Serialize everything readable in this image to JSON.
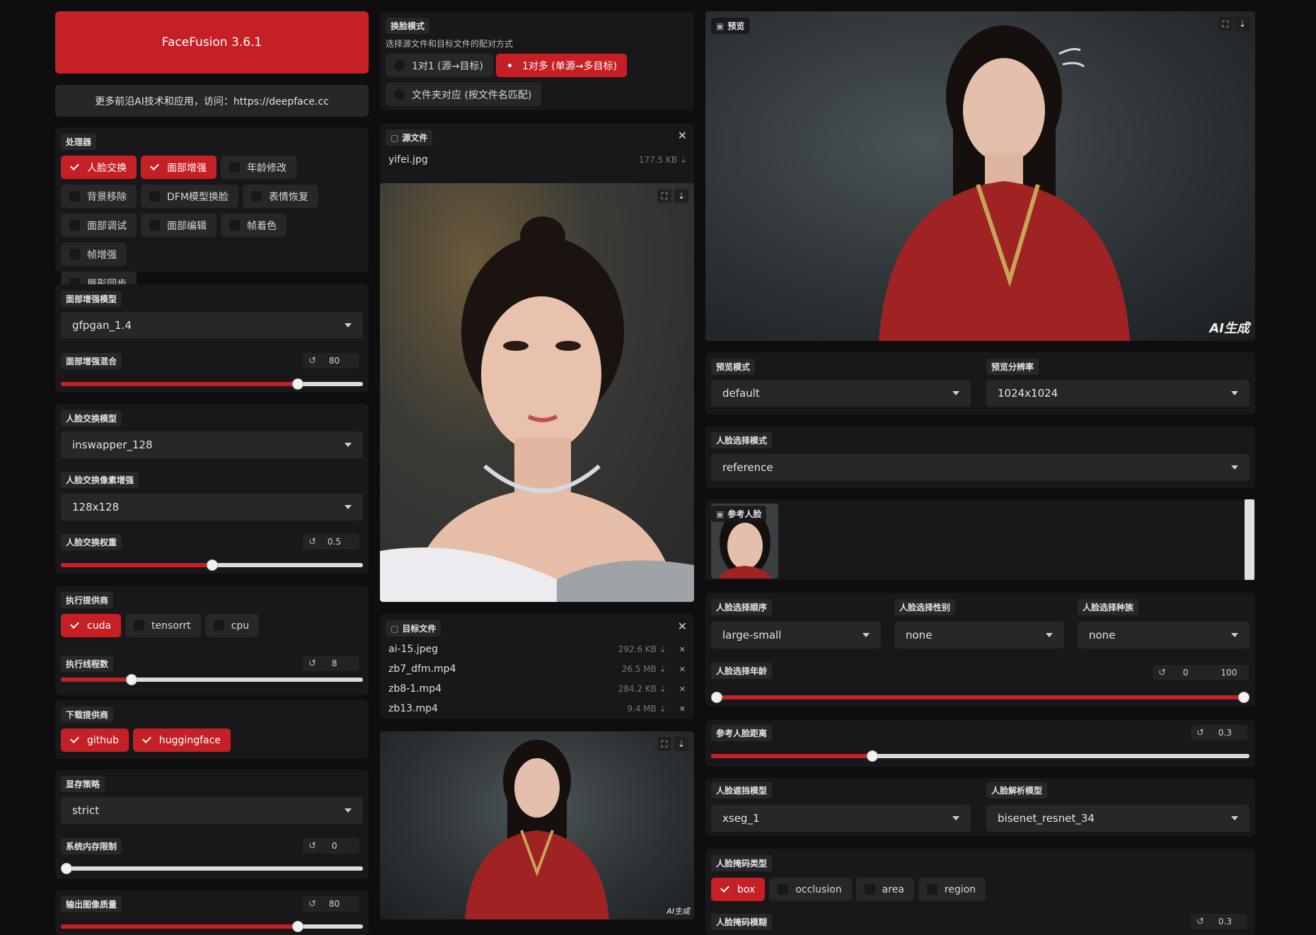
{
  "app": {
    "title": "FaceFusion 3.6.1",
    "banner": "更多前沿AI技术和应用，访问：https://deepface.cc"
  },
  "processors": {
    "label": "处理器",
    "items": [
      {
        "label": "人脸交换",
        "checked": true
      },
      {
        "label": "面部增强",
        "checked": true
      },
      {
        "label": "年龄修改",
        "checked": false
      },
      {
        "label": "背景移除",
        "checked": false
      },
      {
        "label": "DFM模型换脸",
        "checked": false
      },
      {
        "label": "表情恢复",
        "checked": false
      },
      {
        "label": "面部调试",
        "checked": false
      },
      {
        "label": "面部编辑",
        "checked": false
      },
      {
        "label": "帧着色",
        "checked": false
      },
      {
        "label": "帧增强",
        "checked": false
      },
      {
        "label": "唇形同步",
        "checked": false
      }
    ]
  },
  "face_enhancer": {
    "model_label": "面部增强模型",
    "model_value": "gfpgan_1.4",
    "blend_label": "面部增强混合",
    "blend_value": "80",
    "blend_fraction": 0.785
  },
  "face_swapper": {
    "model_label": "人脸交换模型",
    "model_value": "inswapper_128",
    "pixel_boost_label": "人脸交换像素增强",
    "pixel_boost_value": "128x128",
    "weight_label": "人脸交换权重",
    "weight_value": "0.5",
    "weight_fraction": 0.5
  },
  "execution": {
    "providers_label": "执行提供商",
    "providers": [
      {
        "label": "cuda",
        "checked": true
      },
      {
        "label": "tensorrt",
        "checked": false
      },
      {
        "label": "cpu",
        "checked": false
      }
    ],
    "threads_label": "执行线程数",
    "threads_value": "8",
    "threads_fraction": 0.235
  },
  "download": {
    "providers_label": "下载提供商",
    "providers": [
      {
        "label": "github",
        "checked": true
      },
      {
        "label": "huggingface",
        "checked": true
      }
    ]
  },
  "memory": {
    "strategy_label": "显存策略",
    "strategy_value": "strict",
    "limit_label": "系统内存限制",
    "limit_value": "0",
    "limit_fraction": 0.0
  },
  "output": {
    "image_quality_label": "输出图像质量",
    "image_quality_value": "80",
    "image_quality_fraction": 0.785
  },
  "swap_mode": {
    "label": "换脸模式",
    "description": "选择源文件和目标文件的配对方式",
    "options": [
      {
        "label": "1对1 (源→目标)",
        "selected": false
      },
      {
        "label": "1对多 (单源→多目标)",
        "selected": true
      },
      {
        "label": "文件夹对应 (按文件名匹配)",
        "selected": false
      }
    ]
  },
  "source": {
    "label": "源文件",
    "file_name": "yifei.jpg",
    "file_size": "177.5 KB"
  },
  "target": {
    "label": "目标文件",
    "files": [
      {
        "name": "ai-15.jpeg",
        "size": "292.6 KB"
      },
      {
        "name": "zb7_dfm.mp4",
        "size": "26.5 MB"
      },
      {
        "name": "zb8-1.mp4",
        "size": "284.2 KB"
      },
      {
        "name": "zb13.mp4",
        "size": "9.4 MB"
      }
    ]
  },
  "watermark": "AI生成",
  "preview": {
    "label": "预览",
    "mode_label": "预览模式",
    "mode_value": "default",
    "resolution_label": "预览分辨率",
    "resolution_value": "1024x1024"
  },
  "face_selector": {
    "mode_label": "人脸选择模式",
    "mode_value": "reference",
    "reference_label": "参考人脸",
    "order_label": "人脸选择顺序",
    "order_value": "large-small",
    "gender_label": "人脸选择性别",
    "gender_value": "none",
    "race_label": "人脸选择种族",
    "race_value": "none",
    "age_label": "人脸选择年龄",
    "age_start": "0",
    "age_end": "100",
    "age_start_fraction": 0.0,
    "age_end_fraction": 1.0,
    "ref_distance_label": "参考人脸距离",
    "ref_distance_value": "0.3",
    "ref_distance_fraction": 0.3
  },
  "face_masker": {
    "occluder_label": "人脸遮挡模型",
    "occluder_value": "xseg_1",
    "parser_label": "人脸解析模型",
    "parser_value": "bisenet_resnet_34",
    "types_label": "人脸掩码类型",
    "types": [
      {
        "label": "box",
        "checked": true
      },
      {
        "label": "occlusion",
        "checked": false
      },
      {
        "label": "area",
        "checked": false
      },
      {
        "label": "region",
        "checked": false
      }
    ],
    "blur_label": "人脸掩码模糊",
    "blur_value": "0.3"
  },
  "icons": {
    "reset": "reset-icon",
    "fullscreen": "fullscreen-icon",
    "download": "download-icon",
    "close": "close-icon",
    "file": "file-icon",
    "image": "image-icon",
    "dropdown": "chevron-down-icon"
  },
  "colors": {
    "accent": "#c42026",
    "background": "#0e0e10",
    "panel": "#18181b",
    "control": "#27272a"
  }
}
